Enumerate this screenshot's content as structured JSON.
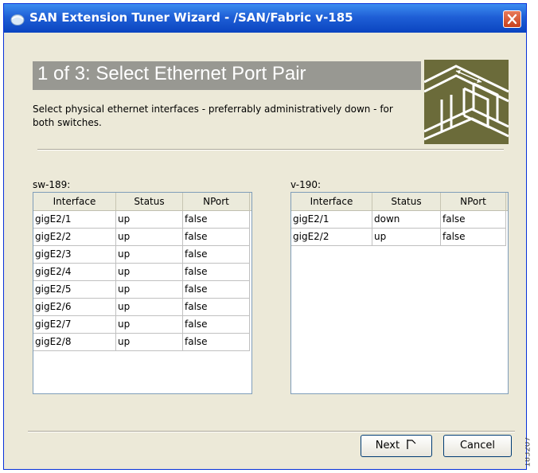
{
  "window": {
    "title": "SAN Extension Tuner Wizard - /SAN/Fabric v-185"
  },
  "wizard": {
    "step_title": "1 of 3: Select Ethernet Port Pair",
    "instruction": "Select physical ethernet interfaces - preferrably administratively down - for both switches."
  },
  "left_table": {
    "switch_label": "sw-189:",
    "columns": [
      "Interface",
      "Status",
      "NPort"
    ],
    "rows": [
      [
        "gigE2/1",
        "up",
        "false"
      ],
      [
        "gigE2/2",
        "up",
        "false"
      ],
      [
        "gigE2/3",
        "up",
        "false"
      ],
      [
        "gigE2/4",
        "up",
        "false"
      ],
      [
        "gigE2/5",
        "up",
        "false"
      ],
      [
        "gigE2/6",
        "up",
        "false"
      ],
      [
        "gigE2/7",
        "up",
        "false"
      ],
      [
        "gigE2/8",
        "up",
        "false"
      ]
    ]
  },
  "right_table": {
    "switch_label": "v-190:",
    "columns": [
      "Interface",
      "Status",
      "NPort"
    ],
    "rows": [
      [
        "gigE2/1",
        "down",
        "false"
      ],
      [
        "gigE2/2",
        "up",
        "false"
      ]
    ]
  },
  "buttons": {
    "next_label": "Next",
    "cancel_label": "Cancel"
  },
  "figure_id": "183207",
  "icons": {
    "app": "app-globe-icon",
    "close": "close-icon",
    "next_arrow": "next-flag-icon",
    "logo": "wizard-logo-icon"
  },
  "colors": {
    "titlebar": "#1f5fd6",
    "header_band": "#989892",
    "logo_bg": "#6b6b3a"
  }
}
